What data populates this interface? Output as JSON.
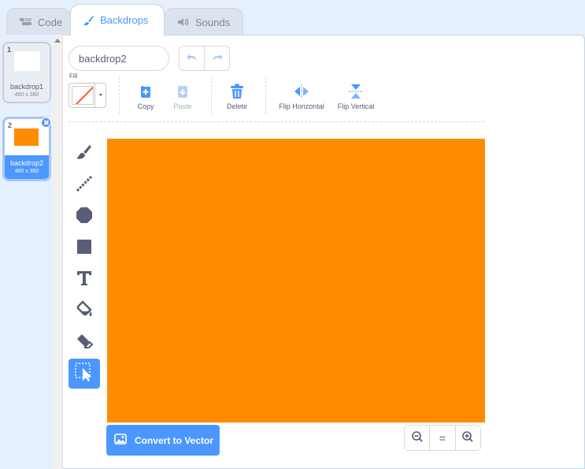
{
  "tabs": {
    "code": "Code",
    "backdrops": "Backdrops",
    "sounds": "Sounds"
  },
  "backdrops": [
    {
      "number": "1",
      "name": "backdrop1",
      "size": "480 x 360",
      "color": "#ffffff",
      "selected": false
    },
    {
      "number": "2",
      "name": "backdrop2",
      "size": "480 x 360",
      "color": "#ff8c00",
      "selected": true
    }
  ],
  "editor": {
    "name_value": "backdrop2",
    "fill_label": "Fill",
    "actions": {
      "copy": "Copy",
      "paste": "Paste",
      "delete": "Delete",
      "flip_horizontal": "Flip Horizontal",
      "flip_vertical": "Flip Vertical"
    },
    "tools": [
      "brush-icon",
      "line-icon",
      "circle-icon",
      "rectangle-icon",
      "text-icon",
      "fill-icon",
      "eraser-icon",
      "select-icon"
    ],
    "selected_tool": "select-icon",
    "canvas_color": "#ff8c00",
    "convert_label": "Convert to Vector",
    "zoom": {
      "out": "−",
      "reset": "=",
      "in": "+"
    }
  },
  "colors": {
    "accent": "#4c97ff",
    "tool_dark": "#575e75"
  }
}
